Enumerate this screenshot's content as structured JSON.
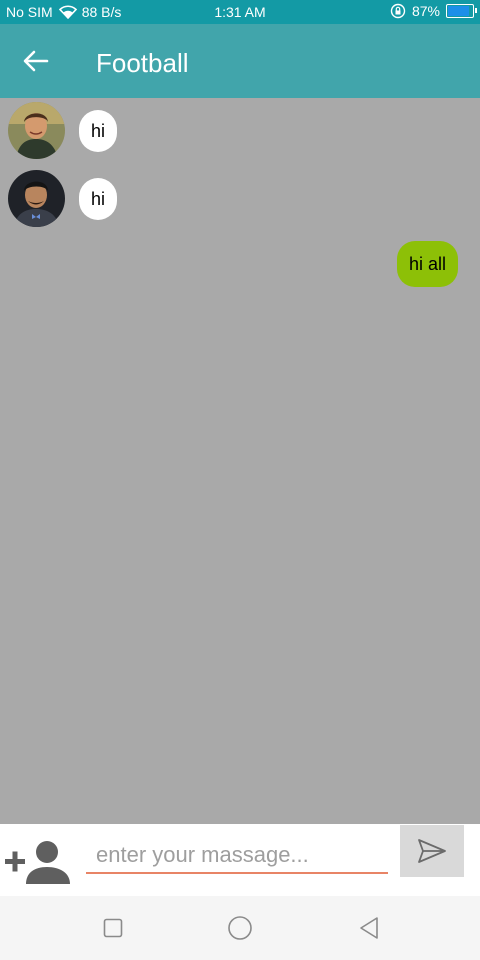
{
  "status_bar": {
    "carrier": "No SIM",
    "network_speed": "88 B/s",
    "time": "1:31 AM",
    "battery": "87%",
    "battery_level": 0.87,
    "icons": [
      "wifi-icon",
      "rotation-lock-icon",
      "battery-icon"
    ]
  },
  "header": {
    "title": "Football",
    "back_icon": "arrow-left-icon"
  },
  "messages": [
    {
      "direction": "incoming",
      "text": "hi",
      "avatar": "user-photo-1"
    },
    {
      "direction": "incoming",
      "text": "hi",
      "avatar": "user-photo-2"
    },
    {
      "direction": "outgoing",
      "text": "hi all"
    }
  ],
  "composer": {
    "add_member_icon": "add-person-icon",
    "placeholder": "enter your massage...",
    "value": "",
    "send_icon": "send-icon"
  },
  "nav_bar": {
    "icons": [
      "recent-apps-icon",
      "home-icon",
      "back-triangle-icon"
    ]
  },
  "colors": {
    "status_bar": "#139aa5",
    "app_bar": "#41a5ab",
    "chat_background": "#a9a9a9",
    "incoming_bubble": "#ffffff",
    "outgoing_bubble": "#8dc007",
    "input_underline": "#e88466"
  }
}
